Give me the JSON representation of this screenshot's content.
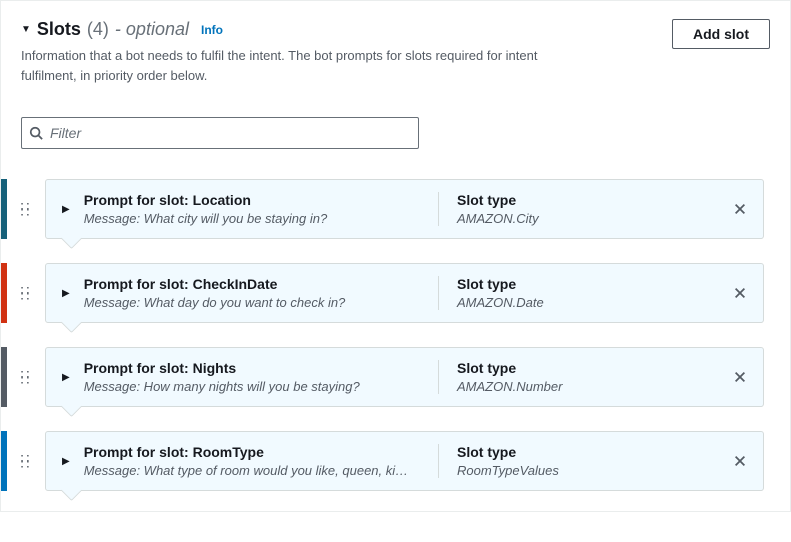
{
  "header": {
    "title": "Slots",
    "count": "(4)",
    "optional": "- optional",
    "info": "Info",
    "description": "Information that a bot needs to fulfil the intent. The bot prompts for slots required for intent fulfilment, in priority order below.",
    "addButton": "Add slot"
  },
  "filter": {
    "placeholder": "Filter"
  },
  "slotTypeLabel": "Slot type",
  "messagePrefix": "Message: ",
  "promptPrefix": "Prompt for slot: ",
  "slots": [
    {
      "name": "Location",
      "message": "What city will you be staying in?",
      "type": "AMAZON.City",
      "color": "c-teal"
    },
    {
      "name": "CheckInDate",
      "message": "What day do you want to check in?",
      "type": "AMAZON.Date",
      "color": "c-red"
    },
    {
      "name": "Nights",
      "message": "How many nights will you be staying?",
      "type": "AMAZON.Number",
      "color": "c-grey"
    },
    {
      "name": "RoomType",
      "message": "What type of room would you like, queen, ki…",
      "type": "RoomTypeValues",
      "color": "c-blue"
    }
  ]
}
